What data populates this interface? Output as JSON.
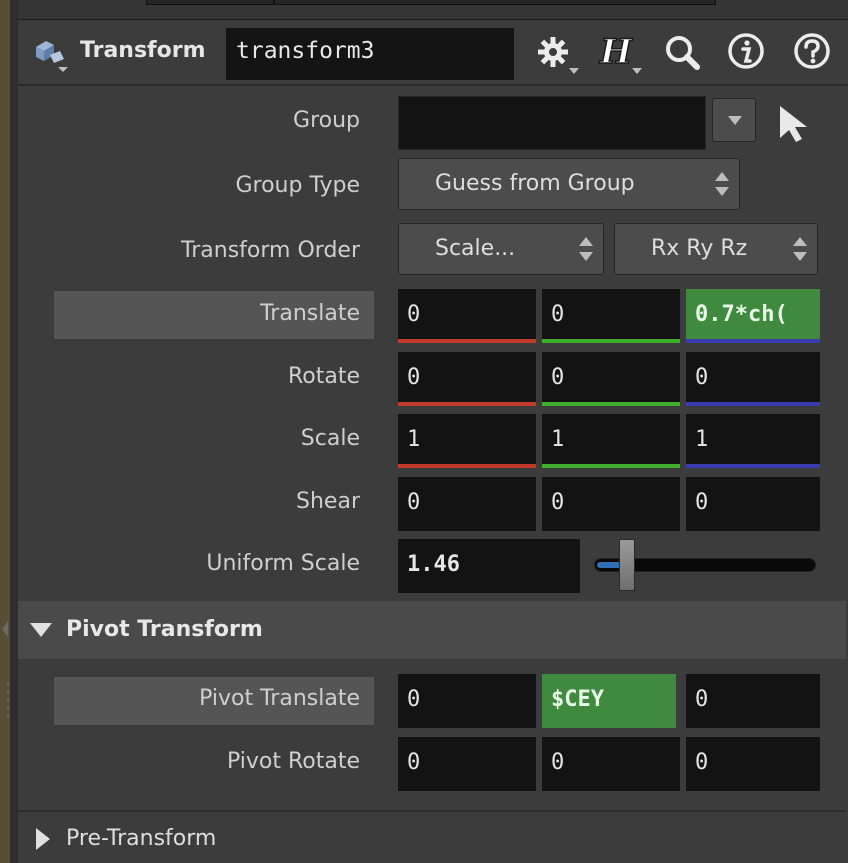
{
  "header": {
    "node_type": "Transform",
    "node_name": "transform3",
    "icons": [
      "node-type-icon",
      "gear-icon",
      "houdini-h-icon",
      "search-icon",
      "info-icon",
      "help-icon"
    ]
  },
  "params": {
    "group": {
      "label": "Group",
      "value": ""
    },
    "group_type": {
      "label": "Group Type",
      "value": "Guess from Group"
    },
    "transform_order": {
      "label": "Transform Order",
      "order": "Scale...",
      "rotation": "Rx Ry Rz"
    },
    "translate": {
      "label": "Translate",
      "x": "0",
      "y": "0",
      "z": "0.7*ch("
    },
    "rotate": {
      "label": "Rotate",
      "x": "0",
      "y": "0",
      "z": "0"
    },
    "scale": {
      "label": "Scale",
      "x": "1",
      "y": "1",
      "z": "1"
    },
    "shear": {
      "label": "Shear",
      "x": "0",
      "y": "0",
      "z": "0"
    },
    "uniform_scale": {
      "label": "Uniform Scale",
      "value": "1.46"
    }
  },
  "pivot": {
    "title": "Pivot Transform",
    "translate": {
      "label": "Pivot Translate",
      "x": "0",
      "y": "$CEY",
      "z": "0"
    },
    "rotate": {
      "label": "Pivot Rotate",
      "x": "0",
      "y": "0",
      "z": "0"
    }
  },
  "pre_transform": {
    "title": "Pre-Transform"
  },
  "colors": {
    "x_axis": "#c0392b",
    "y_axis": "#3fae2a",
    "z_axis": "#3b3bb0",
    "expression_bg": "#3f8a3f",
    "slider_fill": "#2f6fb5"
  }
}
